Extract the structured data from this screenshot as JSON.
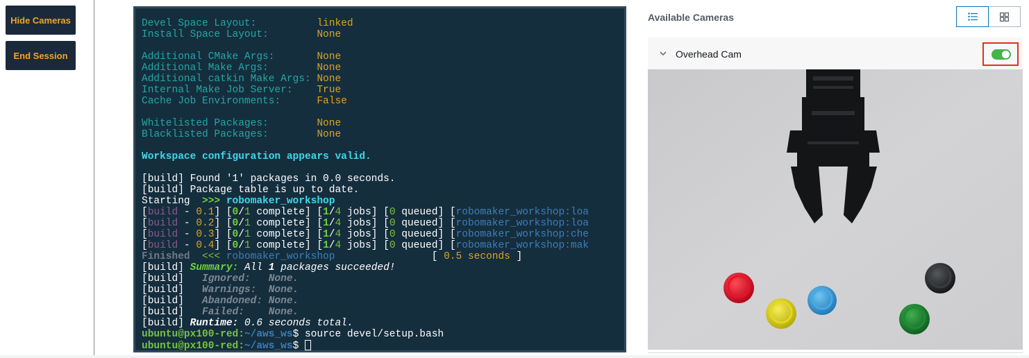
{
  "controls": {
    "hide_cameras": "Hide Cameras",
    "end_session": "End Session"
  },
  "terminal": {
    "config": [
      {
        "label": "Devel Space Layout:          ",
        "value": "linked"
      },
      {
        "label": "Install Space Layout:        ",
        "value": "None"
      },
      {
        "label": "",
        "value": ""
      },
      {
        "label": "Additional CMake Args:       ",
        "value": "None"
      },
      {
        "label": "Additional Make Args:        ",
        "value": "None"
      },
      {
        "label": "Additional catkin Make Args: ",
        "value": "None"
      },
      {
        "label": "Internal Make Job Server:    ",
        "value": "True"
      },
      {
        "label": "Cache Job Environments:      ",
        "value": "False"
      },
      {
        "label": "",
        "value": ""
      },
      {
        "label": "Whitelisted Packages:        ",
        "value": "None"
      },
      {
        "label": "Blacklisted Packages:        ",
        "value": "None"
      }
    ],
    "valid_msg": "Workspace configuration appears valid.",
    "found_msg": "[build] Found '1' packages in 0.0 seconds.",
    "table_msg": "[build] Package table is up to date.",
    "starting": {
      "word": "Starting  ",
      "arrow": ">>> ",
      "pkg": "robomaker_workshop"
    },
    "progress": [
      {
        "t": "0.1",
        "tail": "loa"
      },
      {
        "t": "0.2",
        "tail": "loa"
      },
      {
        "t": "0.3",
        "tail": "che"
      },
      {
        "t": "0.4",
        "tail": "mak"
      }
    ],
    "progress_text": {
      "build": "build",
      "complete": "complete",
      "jobs": "jobs",
      "queued": "queued",
      "pkg": "robomaker_workshop",
      "zero": "0",
      "one": "1",
      "four": "4"
    },
    "finished": {
      "word": "Finished  ",
      "arrow": "<<< ",
      "pkg": "robomaker_workshop",
      "time": " 0.5 seconds "
    },
    "summary": {
      "prefix": "[build] ",
      "label": "Summary:",
      "text": " All ",
      "count": "1",
      "tail": " packages succeeded!"
    },
    "stats": [
      {
        "label": "Ignored:   ",
        "value": "None."
      },
      {
        "label": "Warnings:  ",
        "value": "None."
      },
      {
        "label": "Abandoned: ",
        "value": "None."
      },
      {
        "label": "Failed:    ",
        "value": "None."
      }
    ],
    "runtime": {
      "prefix": "[build] ",
      "label": "Runtime:",
      "text": " 0.6 seconds total."
    },
    "prompt_host": "ubuntu@px100-red:",
    "prompt_path": "~/aws_ws",
    "prompt_symbol": "$ ",
    "command": "source devel/setup.bash"
  },
  "cameras": {
    "title": "Available Cameras",
    "views": [
      {
        "name": "list-view",
        "active": true
      },
      {
        "name": "grid-view",
        "active": false
      }
    ],
    "items": [
      {
        "name": "Overhead Cam",
        "enabled": true
      }
    ]
  }
}
